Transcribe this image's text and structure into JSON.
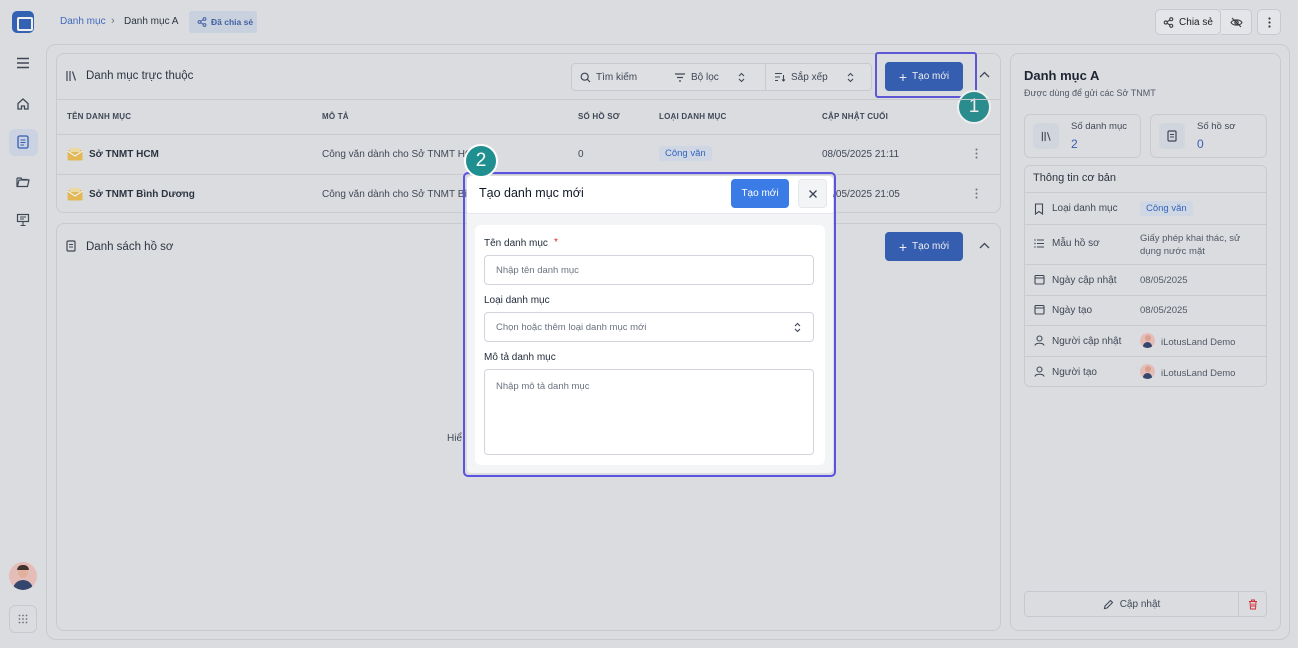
{
  "breadcrumb": {
    "root": "Danh mục",
    "current": "Danh mục A",
    "shared": "Đã chia sẻ"
  },
  "topbar": {
    "share_label": "Chia sẻ"
  },
  "subcategories": {
    "title": "Danh mục trực thuộc",
    "search": "Tìm kiếm",
    "filter": "Bộ lọc",
    "sort": "Sắp xếp",
    "create": "Tạo mới",
    "columns": [
      "TÊN DANH MỤC",
      "MÔ TẢ",
      "SỐ HỒ SƠ",
      "LOẠI DANH MỤC",
      "CẬP NHẬT CUỐI"
    ],
    "rows": [
      {
        "name": "Sở TNMT HCM",
        "desc": "Công văn dành cho Sở TNMT HCM",
        "count": "0",
        "type": "Công văn",
        "updated": "08/05/2025 21:11"
      },
      {
        "name": "Sở TNMT Bình Dương",
        "desc": "Công văn dành cho Sở TNMT Bình Dương",
        "count": "",
        "type": "",
        "updated": "08/05/2025 21:05"
      }
    ]
  },
  "records": {
    "title": "Danh sách hồ sơ",
    "create": "Tạo mới",
    "empty_partial": "Hiể"
  },
  "detail": {
    "title": "Danh mục A",
    "subtitle": "Được dùng để gửi các Sở TNMT",
    "stats": [
      {
        "label": "Số danh mục",
        "value": "2"
      },
      {
        "label": "Số hồ sơ",
        "value": "0"
      }
    ],
    "info_title": "Thông tin cơ bản",
    "info": [
      {
        "label": "Loại danh mục",
        "value": "Công văn"
      },
      {
        "label": "Mẫu hồ sơ",
        "value": "Giấy phép khai thác, sử dụng nước mặt"
      },
      {
        "label": "Ngày cập nhật",
        "value": "08/05/2025"
      },
      {
        "label": "Ngày tạo",
        "value": "08/05/2025"
      },
      {
        "label": "Người cập nhật",
        "value": "iLotusLand Demo"
      },
      {
        "label": "Người tạo",
        "value": "iLotusLand Demo"
      }
    ],
    "update_button": "Cập nhật"
  },
  "modal": {
    "title": "Tạo danh mục mới",
    "submit": "Tạo mới",
    "name_label": "Tên danh mục",
    "required_mark": "*",
    "name_placeholder": "Nhập tên danh mục",
    "type_label": "Loại danh mục",
    "type_placeholder": "Chọn hoặc thêm loại danh mục mới",
    "desc_label": "Mô tả danh mục",
    "desc_placeholder": "Nhập mô tả danh mục"
  },
  "annotations": {
    "step1": "1",
    "step2": "2"
  },
  "colors": {
    "primary": "#2c5bb8",
    "modal_button": "#3a7be6",
    "highlight": "#5a52e0",
    "step_badge": "#1f8f8f",
    "danger": "#dc2626"
  }
}
